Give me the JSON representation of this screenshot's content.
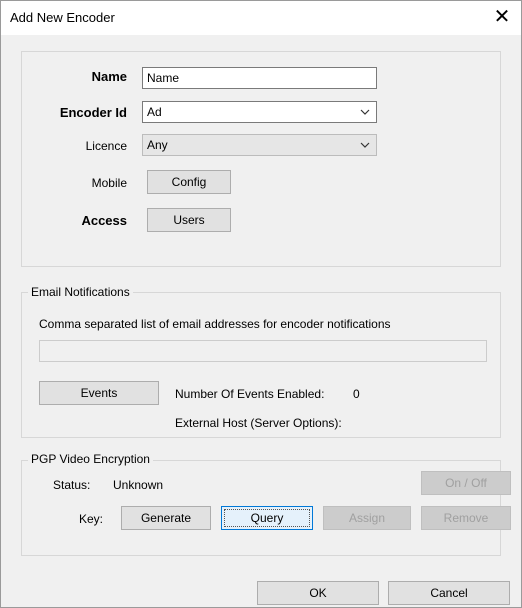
{
  "window": {
    "title": "Add New Encoder"
  },
  "general": {
    "name_label": "Name",
    "name_value": "Name",
    "encoder_id_label": "Encoder Id",
    "encoder_id_value": "Ad",
    "licence_label": "Licence",
    "licence_value": "Any",
    "mobile_label": "Mobile",
    "config_button": "Config",
    "access_label": "Access",
    "users_button": "Users"
  },
  "email": {
    "legend": "Email Notifications",
    "description": "Comma separated list of email addresses for encoder notifications",
    "addresses_value": "",
    "events_button": "Events",
    "events_enabled_label": "Number Of Events Enabled:",
    "events_enabled_count": "0",
    "external_host_label": "External Host (Server Options):"
  },
  "pgp": {
    "legend": "PGP Video Encryption",
    "status_label": "Status:",
    "status_value": "Unknown",
    "onoff_button": "On / Off",
    "key_label": "Key:",
    "generate_button": "Generate",
    "query_button": "Query",
    "assign_button": "Assign",
    "remove_button": "Remove"
  },
  "footer": {
    "ok_button": "OK",
    "cancel_button": "Cancel"
  },
  "icons": {
    "close": "close-icon",
    "dropdown": "chevron-down-icon"
  }
}
